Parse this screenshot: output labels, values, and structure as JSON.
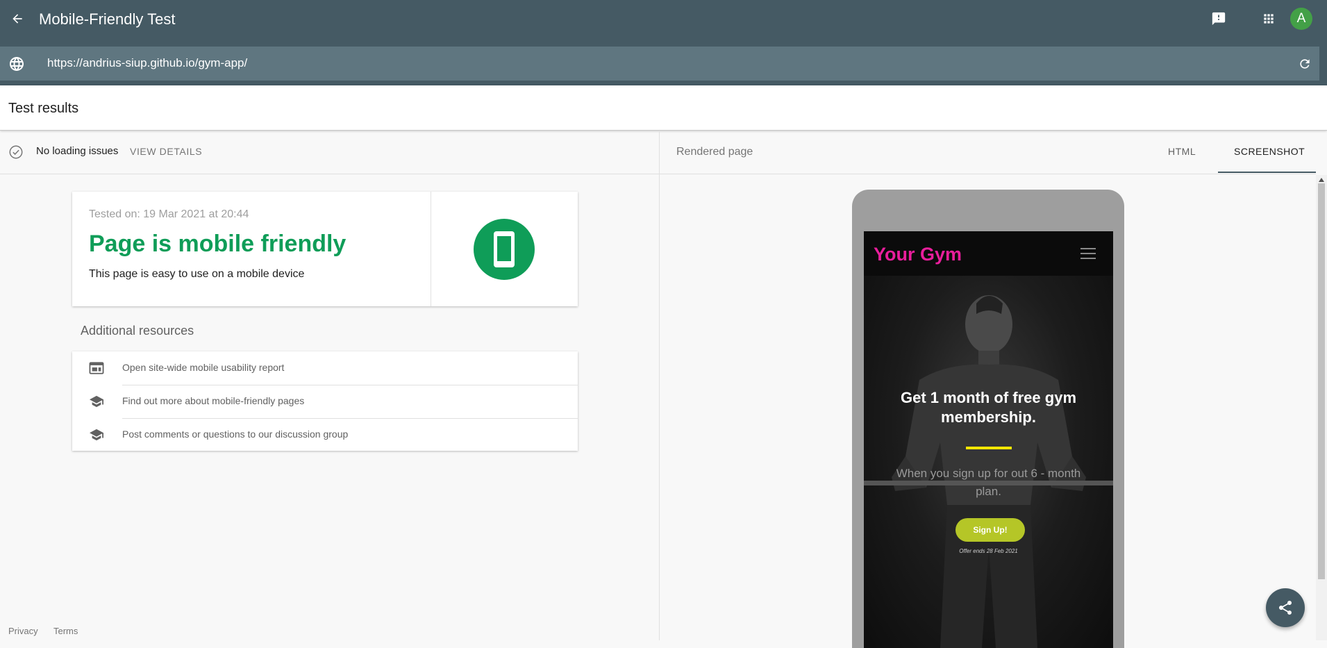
{
  "app": {
    "title": "Mobile-Friendly Test",
    "avatar_letter": "A",
    "url": "https://andrius-siup.github.io/gym-app/"
  },
  "results": {
    "title": "Test results",
    "status_text": "No loading issues",
    "view_details": "VIEW DETAILS",
    "tested_on": "Tested on: 19 Mar 2021 at 20:44",
    "verdict": "Page is mobile friendly",
    "verdict_sub": "This page is easy to use on a mobile device",
    "verdict_color": "#0f9d58"
  },
  "resources": {
    "heading": "Additional resources",
    "items": [
      {
        "label": "Open site-wide mobile usability report",
        "icon": "report-icon"
      },
      {
        "label": "Find out more about mobile-friendly pages",
        "icon": "school-icon"
      },
      {
        "label": "Post comments or questions to our discussion group",
        "icon": "school-icon"
      }
    ]
  },
  "footer": {
    "privacy": "Privacy",
    "terms": "Terms"
  },
  "rendered": {
    "title": "Rendered page",
    "tabs": [
      "HTML",
      "SCREENSHOT"
    ],
    "active_tab": "SCREENSHOT"
  },
  "preview": {
    "logo": "Your Gym",
    "heading": "Get 1 month of free gym membership.",
    "text": "When you sign up for out 6 - month plan.",
    "button": "Sign Up!",
    "offer": "Offer ends 28 Feb 2021",
    "logo_color": "#e91e9c",
    "accent_color": "#f5e600",
    "button_color": "#b5c627"
  },
  "colors": {
    "appbar": "#455a64",
    "url_bar": "#5f7680"
  }
}
